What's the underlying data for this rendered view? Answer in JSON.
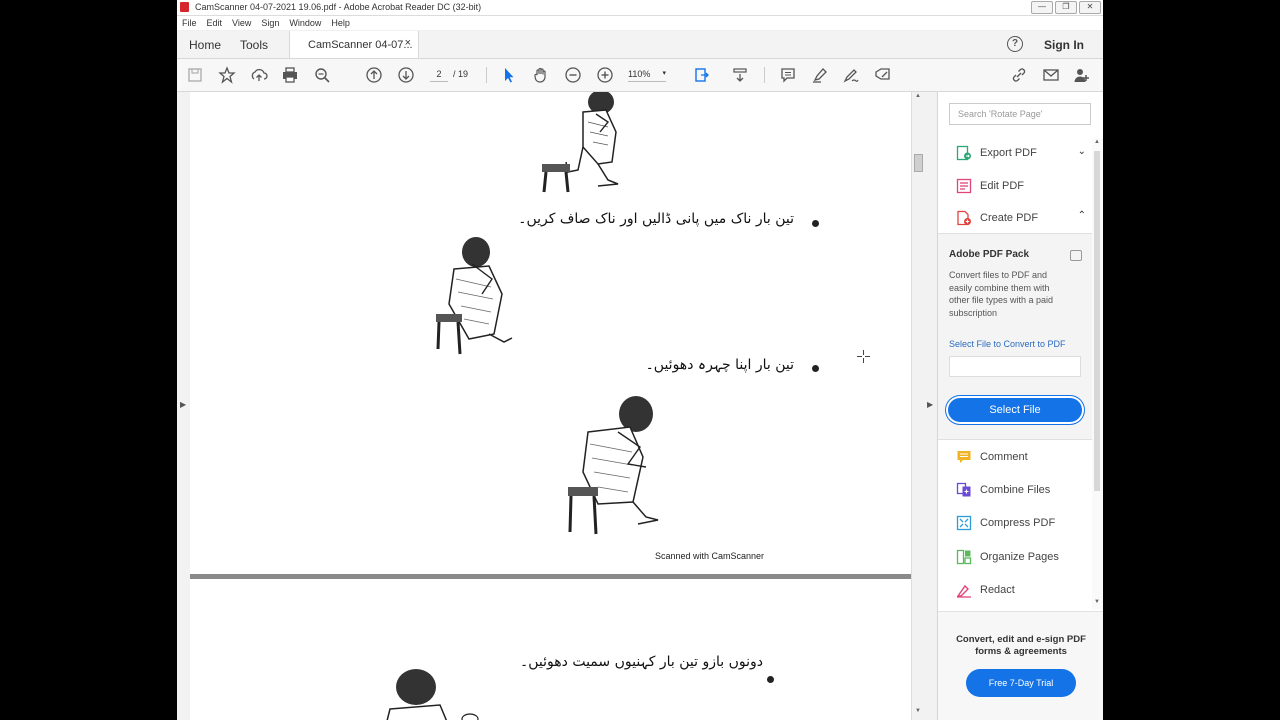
{
  "window": {
    "title": "CamScanner 04-07-2021 19.06.pdf - Adobe Acrobat Reader DC (32-bit)",
    "buttons": [
      "—",
      "❐",
      "✕"
    ]
  },
  "menu": [
    "File",
    "Edit",
    "View",
    "Sign",
    "Window",
    "Help"
  ],
  "tabs": {
    "home": "Home",
    "tools": "Tools",
    "doc": "CamScanner 04-07...",
    "close": "×",
    "help": "?",
    "signin": "Sign In"
  },
  "toolbar": {
    "page_current": "2",
    "page_total": "/ 19",
    "zoom": "110%",
    "zoom_caret": "▾"
  },
  "document": {
    "line1": "تین بار ناک میں پانی ڈالیں اور ناک صاف کریں۔",
    "line2": "تین بار اپنا چہرہ دھوئیں۔",
    "line3": "دونوں بازو تین بار کہنیوں سمیت دھوئیں۔",
    "watermark": "Scanned with CamScanner"
  },
  "right_pane": {
    "search_placeholder": "Search 'Rotate Page'",
    "tools_top": [
      {
        "label": "Export PDF",
        "icon": "export-pdf-icon",
        "color": "#2aa876",
        "chevron": "⌄"
      },
      {
        "label": "Edit PDF",
        "icon": "edit-pdf-icon",
        "color": "#e0457b",
        "chevron": ""
      },
      {
        "label": "Create PDF",
        "icon": "create-pdf-icon",
        "color": "#e0443c",
        "chevron": "⌃"
      }
    ],
    "pack": {
      "title": "Adobe PDF Pack",
      "desc": "Convert files to PDF and easily combine them with other file types with a paid subscription",
      "link": "Select File to Convert to PDF",
      "button": "Select File"
    },
    "tools_bottom": [
      {
        "label": "Comment",
        "icon": "comment-icon",
        "color": "#f0b323"
      },
      {
        "label": "Combine Files",
        "icon": "combine-files-icon",
        "color": "#6b4bd6"
      },
      {
        "label": "Compress PDF",
        "icon": "compress-pdf-icon",
        "color": "#2b9ed8"
      },
      {
        "label": "Organize Pages",
        "icon": "organize-pages-icon",
        "color": "#5cb85c"
      },
      {
        "label": "Redact",
        "icon": "redact-icon",
        "color": "#e0457b"
      }
    ],
    "promo": {
      "text": "Convert, edit and e-sign PDF forms & agreements",
      "button": "Free 7-Day Trial"
    }
  }
}
